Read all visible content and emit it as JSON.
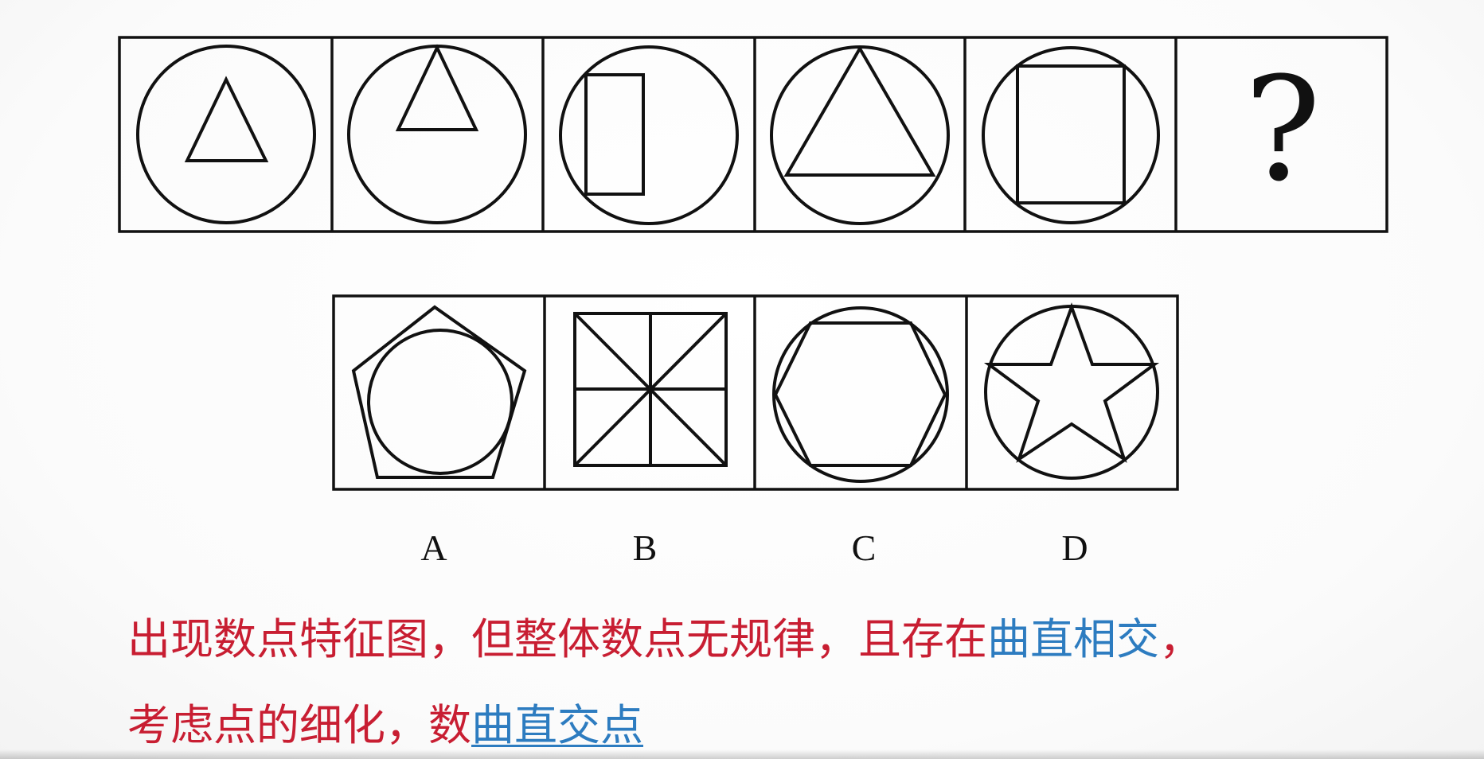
{
  "question_mark": "?",
  "options": {
    "labels": [
      "A",
      "B",
      "C",
      "D"
    ]
  },
  "note": {
    "line1": [
      {
        "text": "出现数点特征图，但整体数点无规律，且存在",
        "color": "red"
      },
      {
        "text": "曲直相交",
        "color": "blue"
      },
      {
        "text": "，",
        "color": "red"
      }
    ],
    "line2": [
      {
        "text": "考虑点的细化，数",
        "color": "red"
      },
      {
        "text": "曲直交点",
        "color": "blue",
        "underline": true
      }
    ]
  },
  "colors": {
    "text_red": "#c81e32",
    "text_blue": "#2d7cc0",
    "stroke": "#111111"
  }
}
